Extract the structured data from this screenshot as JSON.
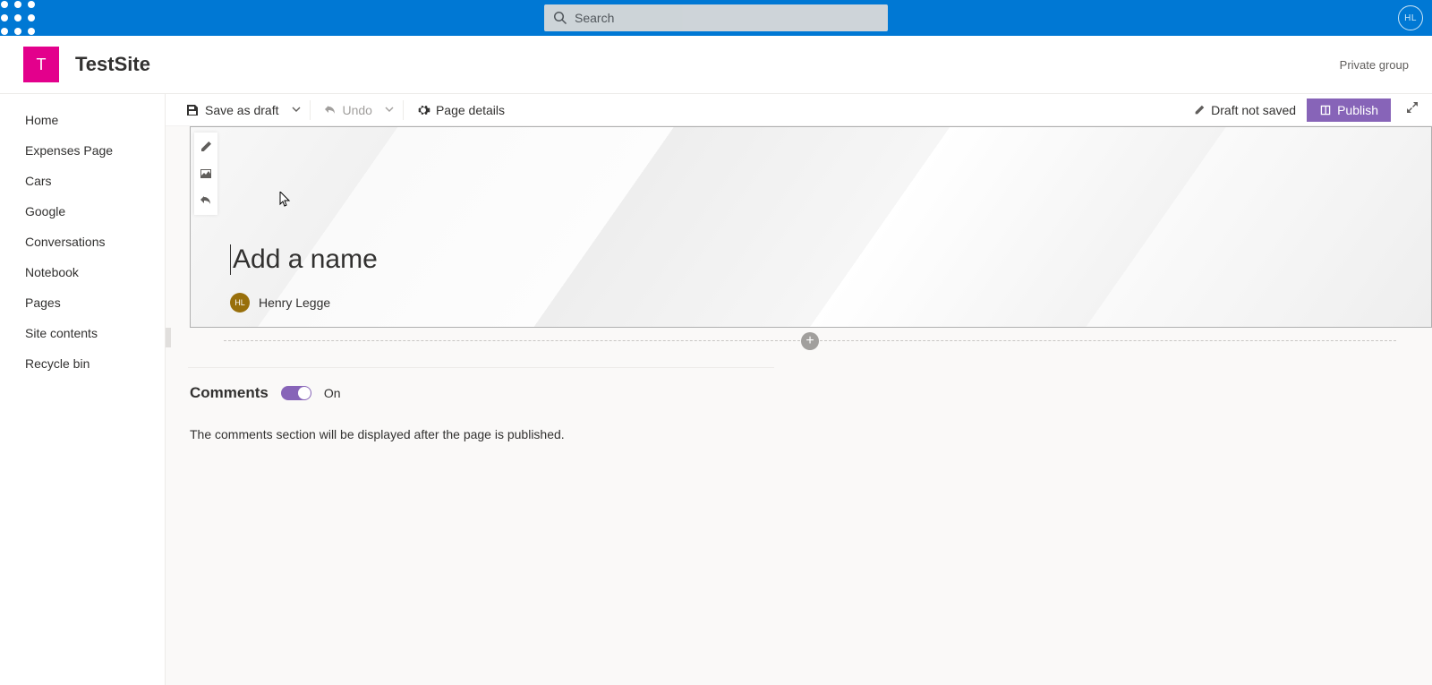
{
  "suite": {
    "search_placeholder": "Search",
    "avatar_initials": "HL"
  },
  "site": {
    "logo_letter": "T",
    "title": "TestSite",
    "privacy": "Private group"
  },
  "nav": {
    "items": [
      "Home",
      "Expenses Page",
      "Cars",
      "Google",
      "Conversations",
      "Notebook",
      "Pages",
      "Site contents",
      "Recycle bin"
    ]
  },
  "cmd": {
    "save": "Save as draft",
    "undo": "Undo",
    "page_details": "Page details",
    "draft_status": "Draft not saved",
    "publish": "Publish"
  },
  "banner": {
    "title_placeholder": "Add a name",
    "author_initials": "HL",
    "author_name": "Henry Legge"
  },
  "comments": {
    "heading": "Comments",
    "state_label": "On",
    "note": "The comments section will be displayed after the page is published."
  }
}
